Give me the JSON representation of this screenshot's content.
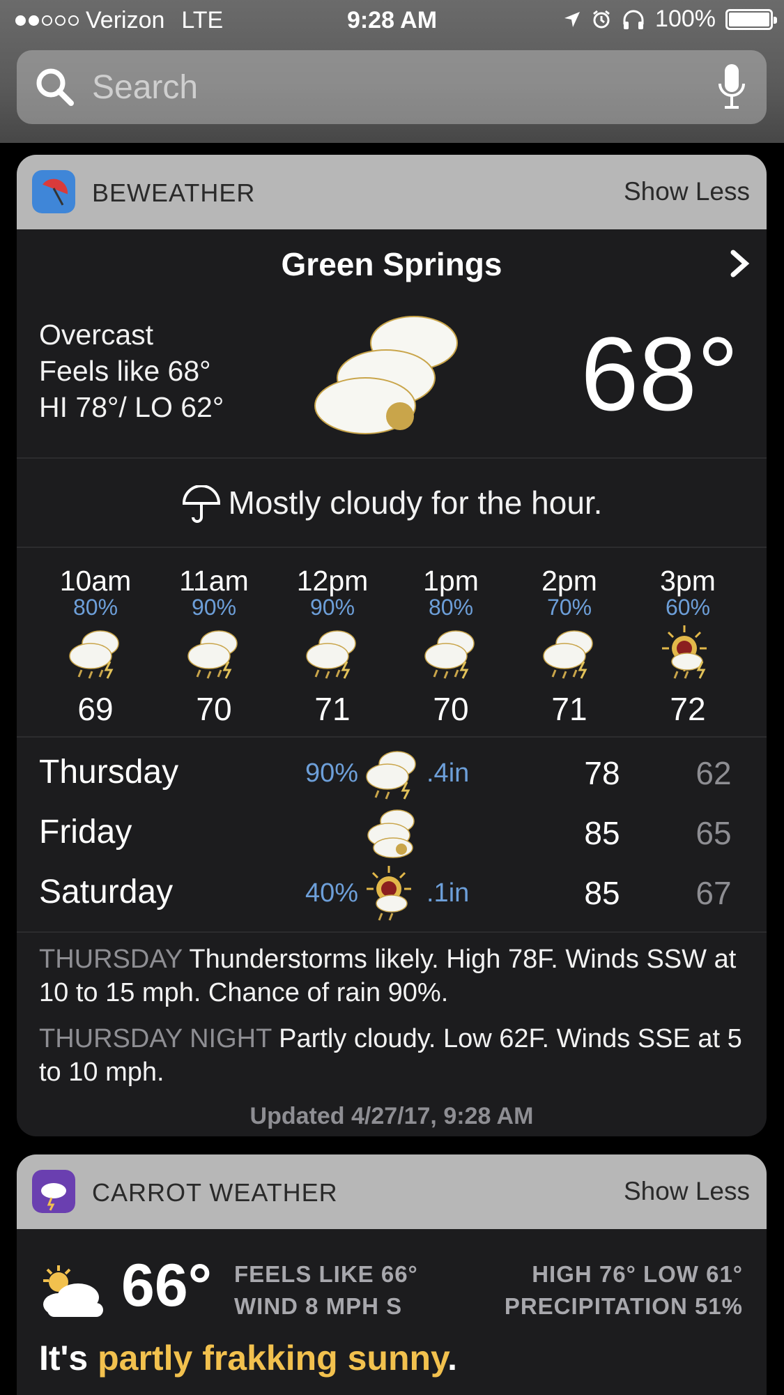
{
  "status_bar": {
    "carrier": "Verizon",
    "network": "LTE",
    "time": "9:28 AM",
    "battery": "100%"
  },
  "search": {
    "placeholder": "Search"
  },
  "beweather": {
    "app_name": "BEWEATHER",
    "action": "Show Less",
    "city": "Green Springs",
    "condition": "Overcast",
    "feels_like": "Feels like 68°",
    "hilo": "HI 78°/ LO 62°",
    "current_temp": "68°",
    "hour_message": "Mostly cloudy for the hour.",
    "hourly": [
      {
        "time": "10am",
        "pct": "80%",
        "temp": "69"
      },
      {
        "time": "11am",
        "pct": "90%",
        "temp": "70"
      },
      {
        "time": "12pm",
        "pct": "90%",
        "temp": "71"
      },
      {
        "time": "1pm",
        "pct": "80%",
        "temp": "70"
      },
      {
        "time": "2pm",
        "pct": "70%",
        "temp": "71"
      },
      {
        "time": "3pm",
        "pct": "60%",
        "temp": "72"
      }
    ],
    "daily": [
      {
        "day": "Thursday",
        "pct": "90%",
        "precip": ".4in",
        "hi": "78",
        "lo": "62"
      },
      {
        "day": "Friday",
        "pct": "",
        "precip": "",
        "hi": "85",
        "lo": "65"
      },
      {
        "day": "Saturday",
        "pct": "40%",
        "precip": ".1in",
        "hi": "85",
        "lo": "67"
      }
    ],
    "forecast": [
      {
        "label": "THURSDAY",
        "text": " Thunderstorms likely. High 78F. Winds SSW at 10 to 15 mph. Chance of rain 90%."
      },
      {
        "label": "THURSDAY NIGHT",
        "text": " Partly cloudy. Low 62F. Winds SSE at 5 to 10 mph."
      }
    ],
    "updated": "Updated 4/27/17, 9:28 AM"
  },
  "carrot": {
    "app_name": "CARROT WEATHER",
    "action": "Show Less",
    "temp": "66°",
    "feels_like": "FEELS LIKE 66°",
    "wind": "WIND 8 MPH S",
    "high_low": "HIGH 76° LOW 61°",
    "precipitation": "PRECIPITATION 51%",
    "phrase_prefix": "It's ",
    "phrase_highlight": "partly frakking sunny",
    "phrase_suffix": "."
  },
  "colors": {
    "accent_blue": "#6d9fd9",
    "carrot_yellow": "#f2c14e",
    "widget_bg": "#1c1c1e",
    "header_bg": "#b7b7b7"
  },
  "icons": [
    "search-icon",
    "mic-icon",
    "location-icon",
    "alarm-icon",
    "headphones-icon",
    "umbrella-icon",
    "chevron-right-icon",
    "cloud-icon",
    "storm-icon",
    "partly-sunny-icon"
  ]
}
